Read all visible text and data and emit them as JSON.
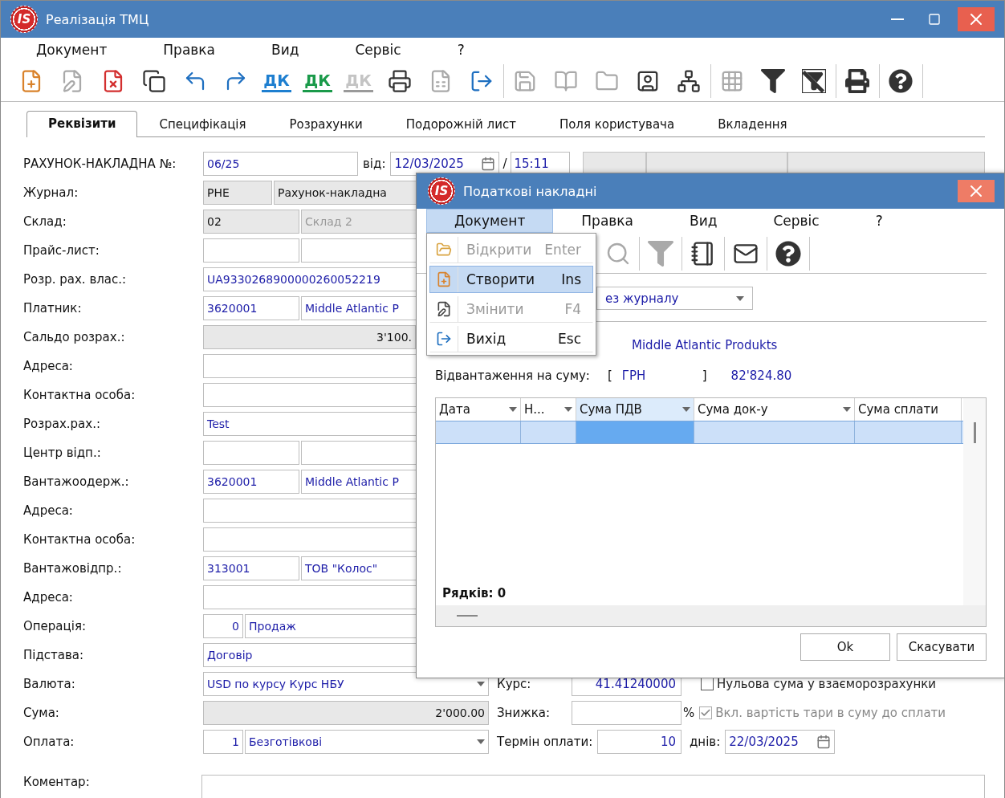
{
  "window": {
    "logo": "IS",
    "title": "Реалізація ТМЦ"
  },
  "menu": [
    {
      "label": "Документ"
    },
    {
      "label": "Правка"
    },
    {
      "label": "Вид"
    },
    {
      "label": "Сервіс"
    },
    {
      "label": "?"
    }
  ],
  "toolbar": [
    [
      {
        "kind": "new",
        "disabled": false
      },
      {
        "kind": "edit",
        "disabled": true
      },
      {
        "kind": "delete",
        "disabled": false
      },
      {
        "kind": "copy",
        "disabled": false
      },
      {
        "kind": "back",
        "disabled": false
      },
      {
        "kind": "forward",
        "disabled": false
      },
      {
        "kind": "dk",
        "label": "ДК",
        "color": "#1e7fd0",
        "disabled": false
      },
      {
        "kind": "dk",
        "label": "ДК",
        "color": "#1a9a4a",
        "disabled": false
      },
      {
        "kind": "dk",
        "label": "ДК",
        "color": "#9a9a9a",
        "disabled": true
      },
      {
        "kind": "print-doc",
        "disabled": false
      },
      {
        "kind": "excel",
        "disabled": true
      },
      {
        "kind": "exit",
        "disabled": false
      }
    ],
    [
      {
        "kind": "save",
        "disabled": true
      },
      {
        "kind": "book",
        "disabled": true
      },
      {
        "kind": "folder",
        "disabled": true
      },
      {
        "kind": "person",
        "disabled": false
      },
      {
        "kind": "hierarchy",
        "disabled": false
      }
    ],
    [
      {
        "kind": "grid",
        "disabled": true
      },
      {
        "kind": "filter",
        "disabled": false
      },
      {
        "kind": "filter-off",
        "disabled": false
      }
    ],
    [
      {
        "kind": "printer",
        "disabled": false
      }
    ],
    [
      {
        "kind": "help",
        "disabled": false
      }
    ]
  ],
  "tabs": [
    {
      "label": "Реквізити",
      "selected": true
    },
    {
      "label": "Специфікація",
      "selected": false
    },
    {
      "label": "Розрахунки",
      "selected": false
    },
    {
      "label": "Подорожній лист",
      "selected": false
    },
    {
      "label": "Поля користувача",
      "selected": false
    },
    {
      "label": "Вкладення",
      "selected": false
    }
  ],
  "header_row": {
    "label": "РАХУНОК-НАКЛАДНА №:",
    "number": "06/25",
    "date_label": "від:",
    "date": "12/03/2025",
    "separator": "/",
    "time": "15:11"
  },
  "rows": [
    {
      "label": "Журнал:",
      "fields": [
        {
          "kind": "short",
          "value": "РНЕ",
          "color": "#111111",
          "readonly": true
        },
        {
          "kind": "wide",
          "value": "Рахунок-накладна",
          "color": "#111111",
          "readonly": true
        }
      ]
    },
    {
      "label": "Склад:",
      "fields": [
        {
          "kind": "code",
          "value": "02",
          "color": "#111111",
          "readonly": true
        },
        {
          "kind": "wide",
          "value": "Склад 2",
          "color": "#999999",
          "readonly": true
        }
      ]
    },
    {
      "label": "Прайс-лист:",
      "fields": [
        {
          "kind": "code",
          "readonly": false
        },
        {
          "kind": "wide",
          "readonly": false
        }
      ]
    },
    {
      "label": "Розр. рах. влас.:",
      "fields": [
        {
          "kind": "wide",
          "value": "UA9330268900000260052219",
          "color": "#1c1ca8",
          "readonly": false
        }
      ]
    },
    {
      "label": "Платник:",
      "fields": [
        {
          "kind": "code",
          "value": "3620001",
          "color": "#1c1ca8",
          "readonly": false
        },
        {
          "kind": "wide",
          "value": "Middle Atlantic P",
          "color": "#1c1ca8",
          "readonly": false
        }
      ]
    },
    {
      "label": "Сальдо розрах.:",
      "fields": [
        {
          "kind": "amount",
          "value": "3'100.",
          "color": "#111111",
          "readonly": true
        }
      ]
    },
    {
      "label": "Адреса:",
      "fields": [
        {
          "kind": "wide",
          "readonly": false
        }
      ]
    },
    {
      "label": "Контактна особа:",
      "fields": [
        {
          "kind": "wide",
          "readonly": false
        }
      ]
    },
    {
      "label": "Розрах.рах.:",
      "fields": [
        {
          "kind": "wide",
          "value": "Test",
          "color": "#1c1ca8",
          "readonly": false
        }
      ]
    },
    {
      "label": "Центр відп.:",
      "fields": [
        {
          "kind": "code",
          "readonly": false
        },
        {
          "kind": "wide",
          "readonly": false
        }
      ]
    },
    {
      "label": "Вантажоодерж.:",
      "fields": [
        {
          "kind": "code",
          "value": "3620001",
          "color": "#1c1ca8",
          "readonly": false
        },
        {
          "kind": "wide",
          "value": "Middle Atlantic P",
          "color": "#1c1ca8",
          "readonly": false
        }
      ]
    },
    {
      "label": "Адреса:",
      "fields": [
        {
          "kind": "wide",
          "readonly": false
        }
      ]
    },
    {
      "label": "Контактна особа:",
      "fields": [
        {
          "kind": "wide",
          "readonly": false
        }
      ]
    },
    {
      "label": "Вантажовідпр.:",
      "fields": [
        {
          "kind": "code",
          "value": "313001",
          "color": "#1c1ca8",
          "readonly": false
        },
        {
          "kind": "wide",
          "value": "ТОВ \"Колос\"",
          "color": "#1c1ca8",
          "readonly": false
        }
      ]
    },
    {
      "label": "Адреса:",
      "fields": [
        {
          "kind": "wide",
          "readonly": false
        }
      ]
    },
    {
      "label": "Операція:",
      "fields": [
        {
          "kind": "num",
          "value": "0",
          "color": "#1c1ca8",
          "readonly": false
        },
        {
          "kind": "wide",
          "value": "Продаж",
          "color": "#1c1ca8",
          "readonly": false
        }
      ]
    },
    {
      "label": "Підстава:",
      "fields": [
        {
          "kind": "wide",
          "value": "Договір",
          "color": "#1c1ca8",
          "readonly": false
        }
      ]
    },
    {
      "label": "Валюта:",
      "fields": [
        {
          "kind": "wide",
          "value": "USD по курсу Курс НБУ",
          "color": "#1c1ca8",
          "readonly": false,
          "dropdown": true
        }
      ],
      "extras": [
        {
          "kind": "label",
          "text": "Курс:"
        },
        {
          "kind": "input",
          "value": "41.41240000"
        },
        {
          "kind": "checkbox",
          "label": "Нульова сума у взаєморозрахунки",
          "checked": false,
          "disabled": false
        }
      ]
    },
    {
      "label": "Сума:",
      "fields": [
        {
          "kind": "amount",
          "value": "2'000.00",
          "color": "#111111",
          "readonly": true
        }
      ],
      "extras": [
        {
          "kind": "label",
          "text": "Знижка:"
        },
        {
          "kind": "input"
        },
        {
          "kind": "text",
          "text": "%"
        },
        {
          "kind": "checkbox",
          "label": "Вкл. вартість тари в суму до сплати",
          "checked": true,
          "disabled": true
        }
      ]
    },
    {
      "label": "Оплата:",
      "fields": [
        {
          "kind": "num",
          "value": "1",
          "color": "#1c1ca8",
          "readonly": false
        },
        {
          "kind": "wide",
          "value": "Безготівкові",
          "color": "#1c1ca8",
          "readonly": false,
          "dropdown": true
        }
      ],
      "extras": [
        {
          "kind": "label",
          "text": "Термін оплати:"
        },
        {
          "kind": "input",
          "value": "10"
        },
        {
          "kind": "label",
          "text": "днів:"
        },
        {
          "kind": "date",
          "value": "22/03/2025"
        }
      ]
    }
  ],
  "comment": {
    "label": "Коментар:"
  },
  "dialog": {
    "logo": "IS",
    "title": "Податкові накладні",
    "menu": [
      {
        "label": "Документ",
        "selected": true
      },
      {
        "label": "Правка",
        "selected": false
      },
      {
        "label": "Вид",
        "selected": false
      },
      {
        "label": "Сервіс",
        "selected": false
      },
      {
        "label": "?",
        "selected": false
      }
    ],
    "dropdown": [
      {
        "kind": "open",
        "label": "Відкрити",
        "shortcut": "Enter",
        "disabled": true,
        "selected": false
      },
      {
        "kind": "new",
        "label": "Створити",
        "shortcut": "Ins",
        "disabled": false,
        "selected": true
      },
      {
        "kind": "edit",
        "label": "Змінити",
        "shortcut": "F4",
        "disabled": true,
        "selected": false
      },
      {
        "kind": "exit",
        "label": "Вихід",
        "shortcut": "Esc",
        "disabled": false,
        "selected": false
      }
    ],
    "toolbar": [
      {
        "kind": "search",
        "disabled": true
      },
      {
        "kind": "filter",
        "disabled": true
      },
      {
        "kind": "notebook",
        "disabled": false
      },
      {
        "kind": "mail",
        "disabled": false
      },
      {
        "kind": "help",
        "disabled": false
      }
    ],
    "journal_select": {
      "value": "ез журналу"
    },
    "counterparty": "Middle Atlantic Produkts",
    "shipment": {
      "label": "Відвантаження на суму:",
      "open": "[",
      "currency": "ГРН",
      "close": "]",
      "amount": "82'824.80"
    },
    "grid": {
      "columns": [
        {
          "label": "Дата",
          "selected": false,
          "filter": true
        },
        {
          "label": "Н...",
          "selected": false,
          "filter": true
        },
        {
          "label": "Сума ПДВ",
          "selected": true,
          "filter": true
        },
        {
          "label": "Сума  док-у",
          "selected": false,
          "filter": true
        },
        {
          "label": "Сума сплати",
          "selected": false,
          "filter": false
        }
      ],
      "rows": [
        {
          "selected": true,
          "cells": [
            {
              "selected": false
            },
            {
              "selected": false
            },
            {
              "selected": true
            },
            {
              "selected": false
            },
            {
              "selected": false
            }
          ]
        }
      ],
      "footer": "Рядків: 0"
    },
    "buttons": [
      {
        "label": "Ok"
      },
      {
        "label": "Скасувати"
      }
    ]
  }
}
